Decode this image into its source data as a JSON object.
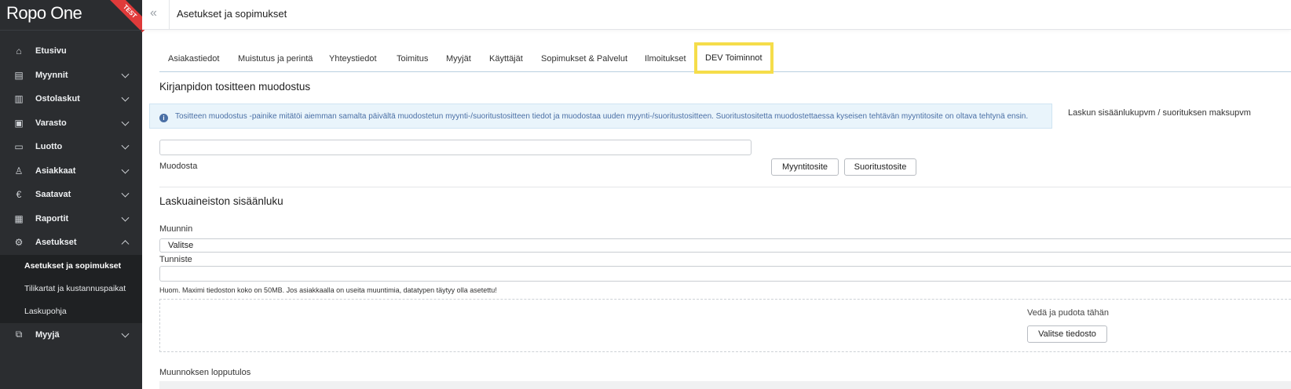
{
  "app": {
    "logo": "Ropo One",
    "badge": "TEST"
  },
  "header": {
    "collapse_icon": "«",
    "title": "Asetukset ja sopimukset"
  },
  "sidebar": {
    "items": [
      {
        "label": "Etusivu",
        "icon": "home-icon",
        "glyph": "⌂"
      },
      {
        "label": "Myynnit",
        "icon": "briefcase-icon",
        "glyph": "▤"
      },
      {
        "label": "Ostolaskut",
        "icon": "document-icon",
        "glyph": "▥"
      },
      {
        "label": "Varasto",
        "icon": "warehouse-icon",
        "glyph": "▣"
      },
      {
        "label": "Luotto",
        "icon": "credit-card-icon",
        "glyph": "▭"
      },
      {
        "label": "Asiakkaat",
        "icon": "user-icon",
        "glyph": "♙"
      },
      {
        "label": "Saatavat",
        "icon": "euro-icon",
        "glyph": "€"
      },
      {
        "label": "Raportit",
        "icon": "report-icon",
        "glyph": "▦"
      },
      {
        "label": "Asetukset",
        "icon": "gear-icon",
        "glyph": "⚙"
      },
      {
        "label": "Myyjä",
        "icon": "seller-icon",
        "glyph": "⧉"
      }
    ],
    "submenu": [
      {
        "label": "Asetukset ja sopimukset"
      },
      {
        "label": "Tilikartat ja kustannuspaikat"
      },
      {
        "label": "Laskupohja"
      }
    ]
  },
  "tabs": [
    {
      "label": "Asiakastiedot"
    },
    {
      "label": "Muistutus ja perintä"
    },
    {
      "label": "Yhteystiedot"
    },
    {
      "label": "Toimitus"
    },
    {
      "label": "Myyjät"
    },
    {
      "label": "Käyttäjät"
    },
    {
      "label": "Sopimukset & Palvelut"
    },
    {
      "label": "Ilmoitukset"
    },
    {
      "label": "DEV Toiminnot"
    }
  ],
  "voucher": {
    "title": "Kirjanpidon tositteen muodostus",
    "info": "Tositteen muodostus -painike mitätöi aiemman samalta päivältä muodostetun myynti-/suoritustositteen tiedot ja muodostaa uuden myynti-/suoritustositteen. Suoritustositetta muodostettaessa kyseisen tehtävän myyntitosite on oltava tehtynä ensin.",
    "date_label": "Laskun sisäänlukupvm / suorituksen maksupvm",
    "create_label": "Muodosta",
    "sales_button": "Myyntitosite",
    "payment_button": "Suoritustosite"
  },
  "import": {
    "title": "Laskuaineiston sisäänluku",
    "converter_label": "Muunnin",
    "converter_value": "Valitse",
    "identifier_label": "Tunniste",
    "note": "Huom. Maximi tiedoston koko on 50MB. Jos asiakkaalla on useita muuntimia, datatypen täytyy olla asetettu!",
    "drop_text": "Vedä ja pudota tähän",
    "choose_file_button": "Valitse tiedosto",
    "result_label": "Muunnoksen lopputulos"
  }
}
